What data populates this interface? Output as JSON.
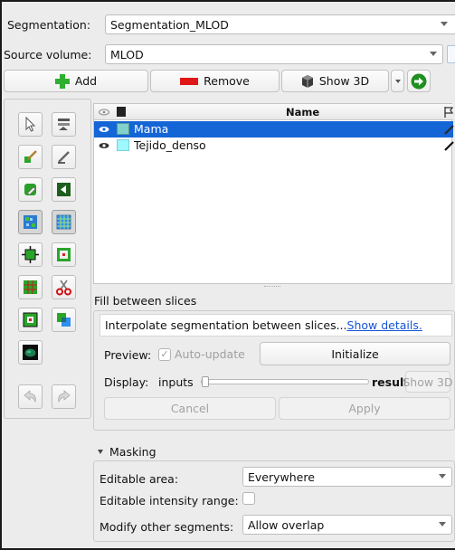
{
  "header": {
    "segmentation_label": "Segmentation:",
    "segmentation_value": "Segmentation_MLOD",
    "source_label": "Source volume:",
    "source_value": "MLOD"
  },
  "toolbar": {
    "add_label": "Add",
    "remove_label": "Remove",
    "show3d_label": "Show 3D"
  },
  "table": {
    "name_header": "Name",
    "rows": [
      {
        "name": "Mama",
        "color": "#80d1c9",
        "selected": true
      },
      {
        "name": "Tejido_denso",
        "color": "#9ff7ff",
        "selected": false
      }
    ]
  },
  "effect": {
    "title": "Fill between slices",
    "help_text": "Interpolate segmentation between slices...",
    "show_details": "Show details.",
    "preview_label": "Preview:",
    "auto_update_label": "Auto-update",
    "initialize_label": "Initialize",
    "display_label": "Display:",
    "inputs_label": "inputs",
    "results_label": "results",
    "show3d_label": "Show 3D",
    "cancel_label": "Cancel",
    "apply_label": "Apply",
    "display_slider_fraction": 0.0
  },
  "masking": {
    "title": "Masking",
    "editable_area_label": "Editable area:",
    "editable_area_value": "Everywhere",
    "intensity_label": "Editable intensity range:",
    "modify_label": "Modify other segments:",
    "modify_value": "Allow overlap"
  },
  "colors": {
    "selection": "#1465d6",
    "add_green": "#2fae2f",
    "remove_red": "#e01717",
    "link_blue": "#1554d6"
  }
}
